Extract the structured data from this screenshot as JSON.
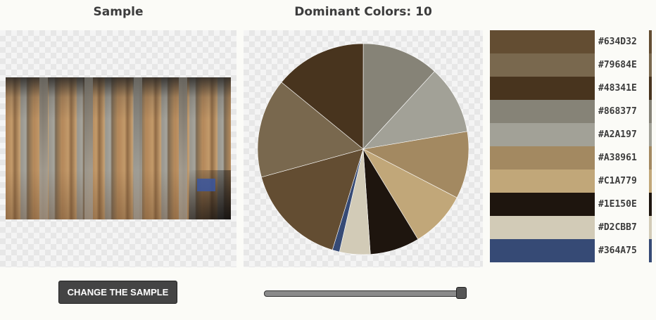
{
  "headings": {
    "sample": "Sample",
    "dominant": "Dominant Colors: 10"
  },
  "sample_photo": {
    "icon": "warehouse-photo"
  },
  "change_button_label": "CHANGE THE SAMPLE",
  "slider": {
    "value": 10,
    "min": 1,
    "max": 10
  },
  "palette": [
    {
      "hex": "#634D32",
      "color": "#634D32"
    },
    {
      "hex": "#79684E",
      "color": "#79684E"
    },
    {
      "hex": "#48341E",
      "color": "#48341E"
    },
    {
      "hex": "#868377",
      "color": "#868377"
    },
    {
      "hex": "#A2A197",
      "color": "#A2A197"
    },
    {
      "hex": "#A38961",
      "color": "#A38961"
    },
    {
      "hex": "#C1A779",
      "color": "#C1A779"
    },
    {
      "hex": "#1E150E",
      "color": "#1E150E"
    },
    {
      "hex": "#D2CBB7",
      "color": "#D2CBB7"
    },
    {
      "hex": "#364A75",
      "color": "#364A75"
    }
  ],
  "chart_data": {
    "type": "pie",
    "slices": [
      {
        "label": "#48341E",
        "color": "#48341E",
        "value": 14.1
      },
      {
        "label": "#868377",
        "color": "#868377",
        "value": 11.8
      },
      {
        "label": "#A2A197",
        "color": "#A2A197",
        "value": 10.5
      },
      {
        "label": "#A38961",
        "color": "#A38961",
        "value": 10.3
      },
      {
        "label": "#C1A779",
        "color": "#C1A779",
        "value": 8.7
      },
      {
        "label": "#1E150E",
        "color": "#1E150E",
        "value": 7.6
      },
      {
        "label": "#D2CBB7",
        "color": "#D2CBB7",
        "value": 4.7
      },
      {
        "label": "#364A75",
        "color": "#364A75",
        "value": 1.1
      },
      {
        "label": "#634D32",
        "color": "#634D32",
        "value": 16.0
      },
      {
        "label": "#79684E",
        "color": "#79684E",
        "value": 15.2
      }
    ]
  }
}
